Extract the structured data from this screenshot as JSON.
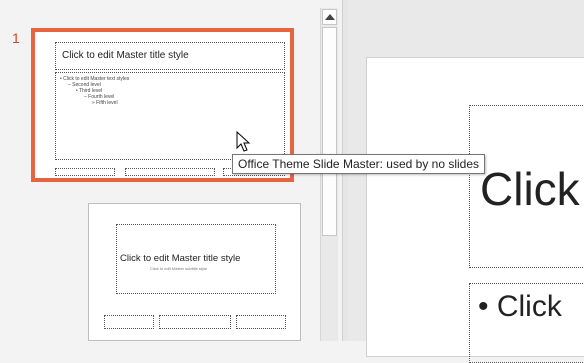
{
  "thumbnails": {
    "master": {
      "number": "1",
      "title": "Click to edit Master title style",
      "body_levels": [
        "• Click to edit Master text styles",
        "– Second level",
        "• Third level",
        "– Fourth level",
        "» Fifth level"
      ]
    },
    "layout": {
      "title": "Click to edit Master title style",
      "subtitle": "Click to edit Master subtitle style"
    }
  },
  "editor": {
    "title_fragment": "Click",
    "bullet_fragment": "• Click"
  },
  "tooltip": "Office Theme Slide Master: used by no slides",
  "colors": {
    "selection_border": "#e8633f",
    "slide_number": "#d24726"
  }
}
